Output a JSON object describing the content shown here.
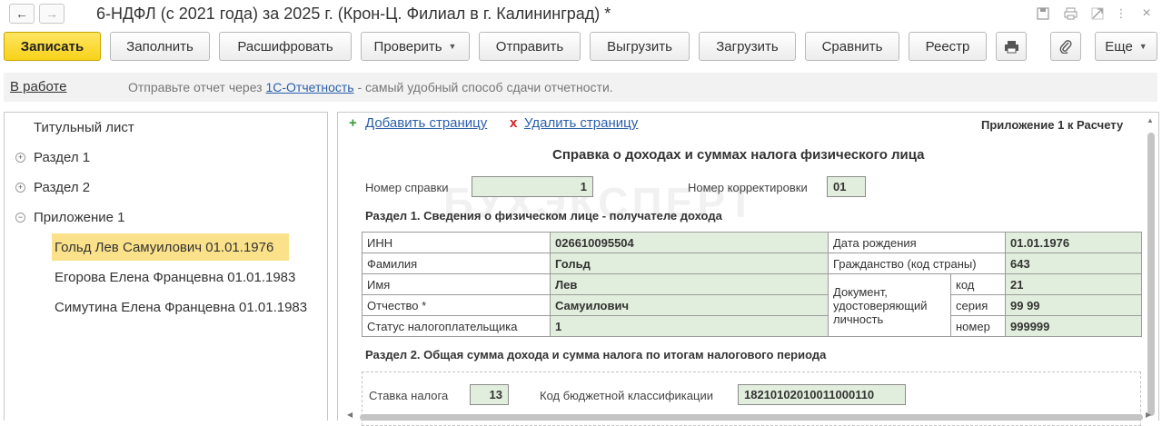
{
  "window": {
    "title": "6-НДФЛ (с 2021 года) за 2025 г. (Крон-Ц. Филиал в г. Калининград) *"
  },
  "toolbar": {
    "record": "Записать",
    "fill": "Заполнить",
    "decode": "Расшифровать",
    "check": "Проверить",
    "send": "Отправить",
    "export": "Выгрузить",
    "load": "Загрузить",
    "compare": "Сравнить",
    "registry": "Реестр",
    "more": "Еще"
  },
  "info": {
    "status": "В работе",
    "text_before": "Отправьте отчет через ",
    "link": "1С-Отчетность",
    "text_after": " - самый удобный способ сдачи отчетности."
  },
  "tree": {
    "title_page": "Титульный лист",
    "section1": "Раздел 1",
    "section2": "Раздел 2",
    "appendix1": "Приложение 1",
    "persons": [
      "Гольд Лев Самуилович 01.01.1976",
      "Егорова Елена Францевна 01.01.1983",
      "Симутина Елена Францевна 01.01.1983"
    ]
  },
  "form": {
    "add_page": "Добавить страницу",
    "delete_page": "Удалить страницу",
    "appendix_label": "Приложение 1 к Расчету",
    "title": "Справка о доходах и суммах налога физического лица",
    "cert_number_label": "Номер справки",
    "cert_number": "1",
    "correction_label": "Номер корректировки",
    "correction": "01",
    "section1_title": "Раздел 1. Сведения о физическом лице - получателе дохода",
    "person": {
      "inn_label": "ИНН",
      "inn": "026610095504",
      "surname_label": "Фамилия",
      "surname": "Гольд",
      "name_label": "Имя",
      "name": "Лев",
      "patronymic_label": "Отчество *",
      "patronymic": "Самуилович",
      "status_label": "Статус налогоплательщика",
      "status": "1",
      "birth_label": "Дата рождения",
      "birth": "01.01.1976",
      "citizenship_label": "Гражданство (код страны)",
      "citizenship": "643",
      "document_label": "Документ, удостоверяющий личность",
      "doc_code_label": "код",
      "doc_code": "21",
      "doc_series_label": "серия",
      "doc_series": "99 99",
      "doc_number_label": "номер",
      "doc_number": "999999"
    },
    "section2_title": "Раздел 2. Общая сумма дохода и сумма налога по итогам налогового периода",
    "tax_rate_label": "Ставка налога",
    "tax_rate": "13",
    "kbk_label": "Код бюджетной классификации",
    "kbk": "18210102010011000110"
  },
  "watermark": "БУХЭКСПЕРТ"
}
